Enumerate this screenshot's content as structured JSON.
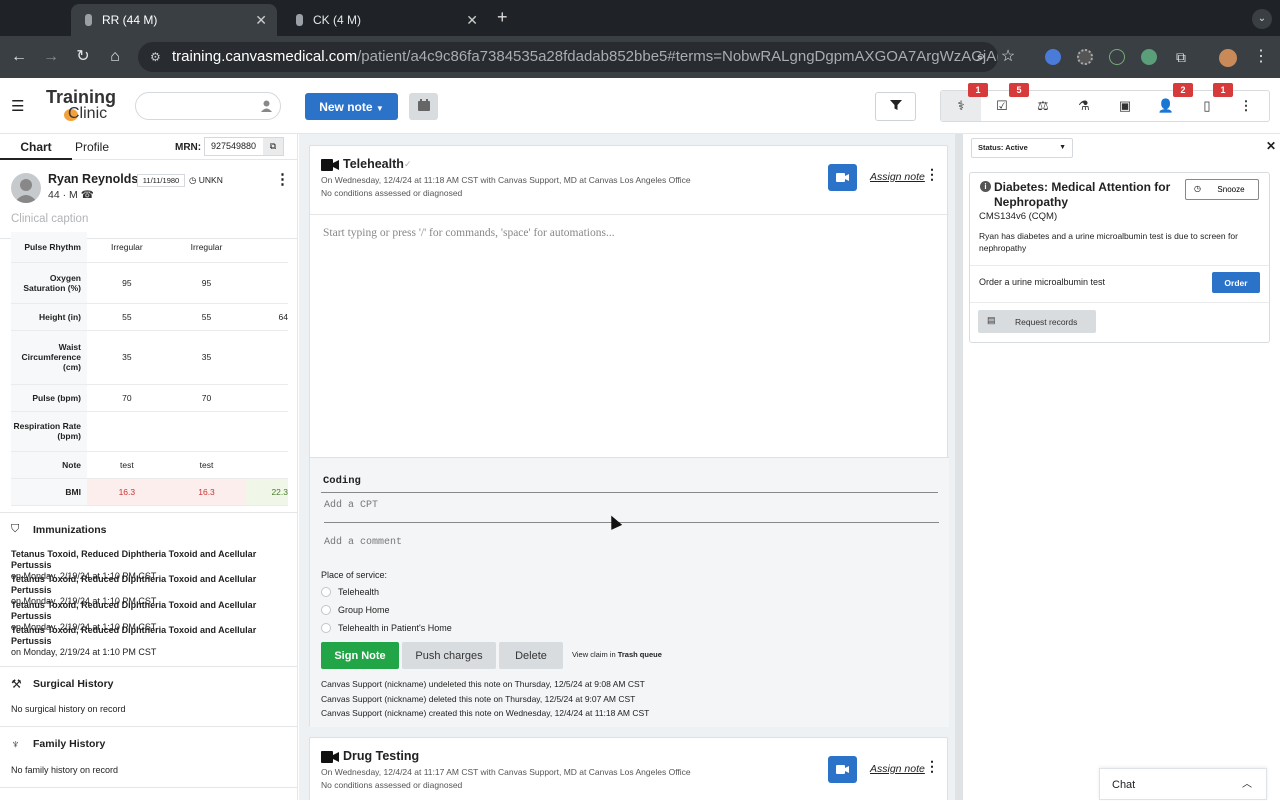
{
  "browser": {
    "tabs": [
      {
        "title": "RR (44 M)",
        "active": true
      },
      {
        "title": "CK (4 M)",
        "active": false
      }
    ],
    "url_host": "training.canvasmedical.com",
    "url_path": "/patient/a4c9c86fa7384535a28fdadab852bbe5#terms=NobwRALgngDgpmAXGOA7ArgWzAGjAMwEs4A..."
  },
  "app": {
    "logo_line1": "Training",
    "logo_line2": "Clinic",
    "new_note_label": "New note",
    "toolbar_badges": {
      "vitals": "1",
      "tasks": "5",
      "people": "2",
      "docs": "1"
    }
  },
  "patient": {
    "tab_chart": "Chart",
    "tab_profile": "Profile",
    "mrn_label": "MRN:",
    "mrn": "927549880",
    "name": "Ryan Reynolds",
    "dob": "11/11/1980",
    "status": "UNKN",
    "age_sex": "44 · M",
    "caption_placeholder": "Clinical caption"
  },
  "vitals": [
    {
      "label": "Pulse Rhythm",
      "v1": "Irregular",
      "v2": "Irregular",
      "v3": ""
    },
    {
      "label": "Oxygen Saturation (%)",
      "v1": "95",
      "v2": "95",
      "v3": ""
    },
    {
      "label": "Height (in)",
      "v1": "55",
      "v2": "55",
      "v3": "64"
    },
    {
      "label": "Waist Circumference (cm)",
      "v1": "35",
      "v2": "35",
      "v3": ""
    },
    {
      "label": "Pulse (bpm)",
      "v1": "70",
      "v2": "70",
      "v3": ""
    },
    {
      "label": "Respiration Rate (bpm)",
      "v1": "",
      "v2": "",
      "v3": ""
    },
    {
      "label": "Note",
      "v1": "test",
      "v2": "test",
      "v3": ""
    },
    {
      "label": "BMI",
      "v1": "16.3",
      "v2": "16.3",
      "v3": "22.3"
    }
  ],
  "immunizations": {
    "title": "Immunizations",
    "items": [
      {
        "name": "Tetanus Toxoid, Reduced Diphtheria Toxoid and Acellular Pertussis",
        "date": "on Monday, 2/19/24 at 1:10 PM CST"
      },
      {
        "name": "Tetanus Toxoid, Reduced Diphtheria Toxoid and Acellular Pertussis",
        "date": "on Monday, 2/19/24 at 1:10 PM CST"
      },
      {
        "name": "Tetanus Toxoid, Reduced Diphtheria Toxoid and Acellular Pertussis",
        "date": "on Monday, 2/19/24 at 1:10 PM CST"
      },
      {
        "name": "Tetanus Toxoid, Reduced Diphtheria Toxoid and Acellular Pertussis",
        "date": "on Monday, 2/19/24 at 1:10 PM CST"
      }
    ]
  },
  "surgical": {
    "title": "Surgical History",
    "empty": "No surgical history on record"
  },
  "family": {
    "title": "Family History",
    "empty": "No family history on record"
  },
  "note1": {
    "title": "Telehealth",
    "meta": "On Wednesday, 12/4/24 at 11:18 AM CST with Canvas Support, MD at Canvas Los Angeles Office",
    "conditions": "No conditions assessed or diagnosed",
    "assign": "Assign note",
    "editor_placeholder": "Start typing or press '/' for commands, 'space' for automations...",
    "coding_title": "Coding",
    "cpt_placeholder": "Add a CPT",
    "comment_placeholder": "Add a comment",
    "pos_label": "Place of service:",
    "pos_options": [
      "Telehealth",
      "Group Home",
      "Telehealth in Patient's Home"
    ],
    "sign_label": "Sign Note",
    "push_label": "Push charges",
    "delete_label": "Delete",
    "view_claim_prefix": "View claim in ",
    "view_claim_link": "Trash queue",
    "history": [
      "Canvas Support (nickname) undeleted this note on Thursday, 12/5/24 at 9:08 AM CST",
      "Canvas Support (nickname) deleted this note on Thursday, 12/5/24 at 9:07 AM CST",
      "Canvas Support (nickname) created this note on Wednesday, 12/4/24 at 11:18 AM CST"
    ]
  },
  "note2": {
    "title": "Drug Testing",
    "meta": "On Wednesday, 12/4/24 at 11:17 AM CST with Canvas Support, MD at Canvas Los Angeles Office",
    "conditions": "No conditions assessed or diagnosed",
    "assign": "Assign note"
  },
  "protocols": {
    "status_label": "Status: Active",
    "card_title": "Diabetes: Medical Attention for Nephropathy",
    "snooze_label": "Snooze",
    "code": "CMS134v6 (CQM)",
    "desc": "Ryan has diabetes and a urine microalbumin test is due to screen for nephropathy",
    "action_text": "Order a urine microalbumin test",
    "order_label": "Order",
    "request_label": "Request records"
  },
  "chat_label": "Chat",
  "colors": {
    "primary": "#2b72c9",
    "sign": "#21a546",
    "badge": "#d63a3a",
    "bmi_low": "#fdeeee",
    "bmi_ok": "#f0f7e9"
  }
}
